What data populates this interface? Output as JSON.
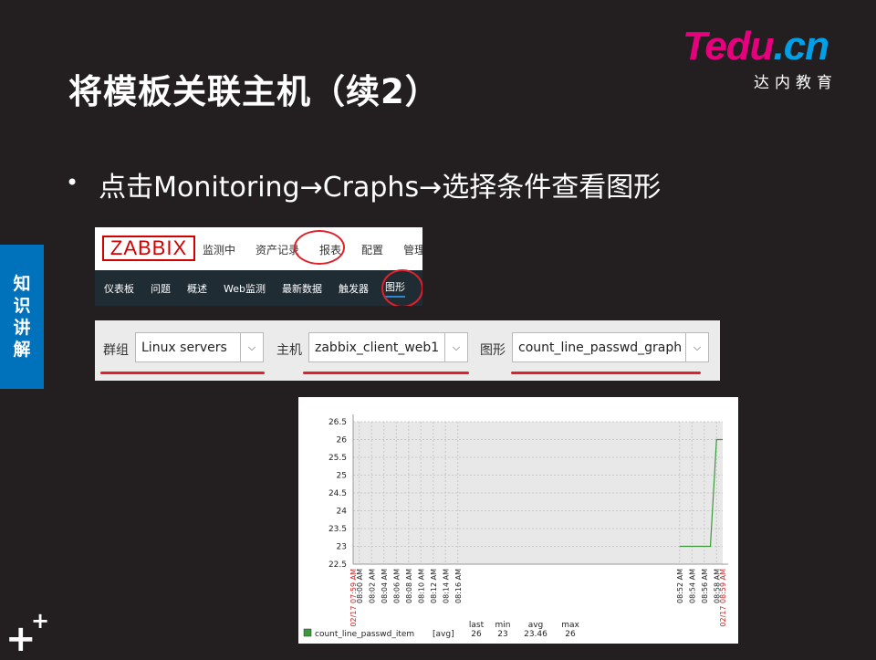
{
  "logo": {
    "brand_a": "Tedu",
    "brand_b": ".cn",
    "subtitle": "达内教育"
  },
  "slide": {
    "title": "将模板关联主机（续2）",
    "bullet": "点击Monitoring→Craphs→选择条件查看图形",
    "side_tag": [
      "知",
      "识",
      "讲",
      "解"
    ]
  },
  "zabbix_nav": {
    "logo": "ZABBIX",
    "top_menu": [
      "监测中",
      "资产记录",
      "报表",
      "配置",
      "管理"
    ],
    "sub_menu": [
      "仪表板",
      "问题",
      "概述",
      "Web监测",
      "最新数据",
      "触发器",
      "图形"
    ]
  },
  "filter": {
    "group_label": "群组",
    "group_value": "Linux servers",
    "host_label": "主机",
    "host_value": "zabbix_client_web1",
    "graph_label": "图形",
    "graph_value": "count_line_passwd_graph"
  },
  "chart_data": {
    "type": "line",
    "yticks": [
      "26.5",
      "26",
      "25.5",
      "25",
      "24.5",
      "24",
      "23.5",
      "23",
      "22.5"
    ],
    "ylim": [
      22.5,
      26.5
    ],
    "start_label": "02/17 07:59 AM",
    "end_label": "02/17 08:59 AM",
    "xticks": [
      "08:00 AM",
      "08:02 AM",
      "08:04 AM",
      "08:06 AM",
      "08:08 AM",
      "08:10 AM",
      "08:12 AM",
      "08:14 AM",
      "08:16 AM",
      "08:52 AM",
      "08:54 AM",
      "08:56 AM",
      "08:58 AM"
    ],
    "series": [
      {
        "name": "count_line_passwd_item",
        "color": "#3a9a3a",
        "x": [
          "08:52 AM",
          "08:57 AM",
          "08:58 AM",
          "08:59 AM"
        ],
        "values": [
          23,
          23,
          26,
          26
        ]
      }
    ],
    "legend": {
      "item": "count_line_passwd_item",
      "func": "[avg]",
      "headers": [
        "last",
        "min",
        "avg",
        "max"
      ],
      "values": [
        "26",
        "23",
        "23.46",
        "26"
      ]
    },
    "grid": true
  },
  "colors": {
    "accent_red": "#e0202a",
    "side_blue": "#0072bc",
    "zabbix_nav": "#1f2c33"
  }
}
